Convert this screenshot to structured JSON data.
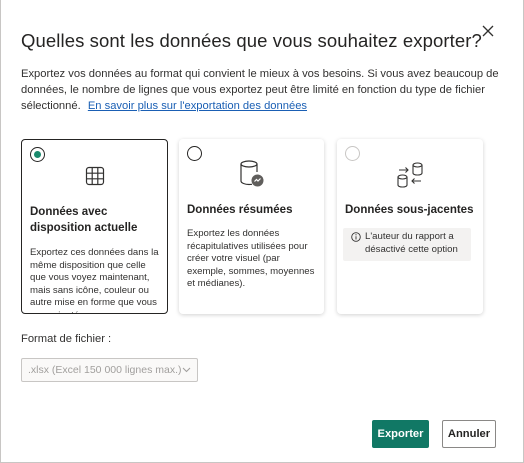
{
  "dialog": {
    "title": "Quelles sont les données que vous souhaitez exporter?",
    "description": "Exportez vos données au format qui convient le mieux à vos besoins. Si vous avez beaucoup de données, le nombre de lignes que vous exportez peut être limité en fonction du type de fichier sélectionné.",
    "learn_more_link": "En savoir plus sur l'exportation des données"
  },
  "options": [
    {
      "title": "Données avec disposition actuelle",
      "body": "Exportez ces données dans la même disposition que celle que vous voyez maintenant, mais sans icône, couleur ou autre mise en forme que vous avez ajoutée.",
      "selected": true,
      "disabled": false,
      "icon": "table-grid-icon"
    },
    {
      "title": "Données résumées",
      "body": "Exportez les données récapitulatives utilisées pour créer votre visuel (par exemple, sommes, moyennes et médianes).",
      "selected": false,
      "disabled": false,
      "icon": "database-summary-icon"
    },
    {
      "title": "Données sous-jacentes",
      "info": "L'auteur du rapport a désactivé cette option",
      "selected": false,
      "disabled": true,
      "icon": "database-transfer-icon"
    }
  ],
  "file_format": {
    "label": "Format de fichier :",
    "value": ".xlsx (Excel 150 000 lignes max.)"
  },
  "buttons": {
    "export": "Exporter",
    "cancel": "Annuler"
  },
  "colors": {
    "accent": "#117865",
    "radio_checked": "#1a8a6d",
    "link": "#1a5fb4"
  }
}
